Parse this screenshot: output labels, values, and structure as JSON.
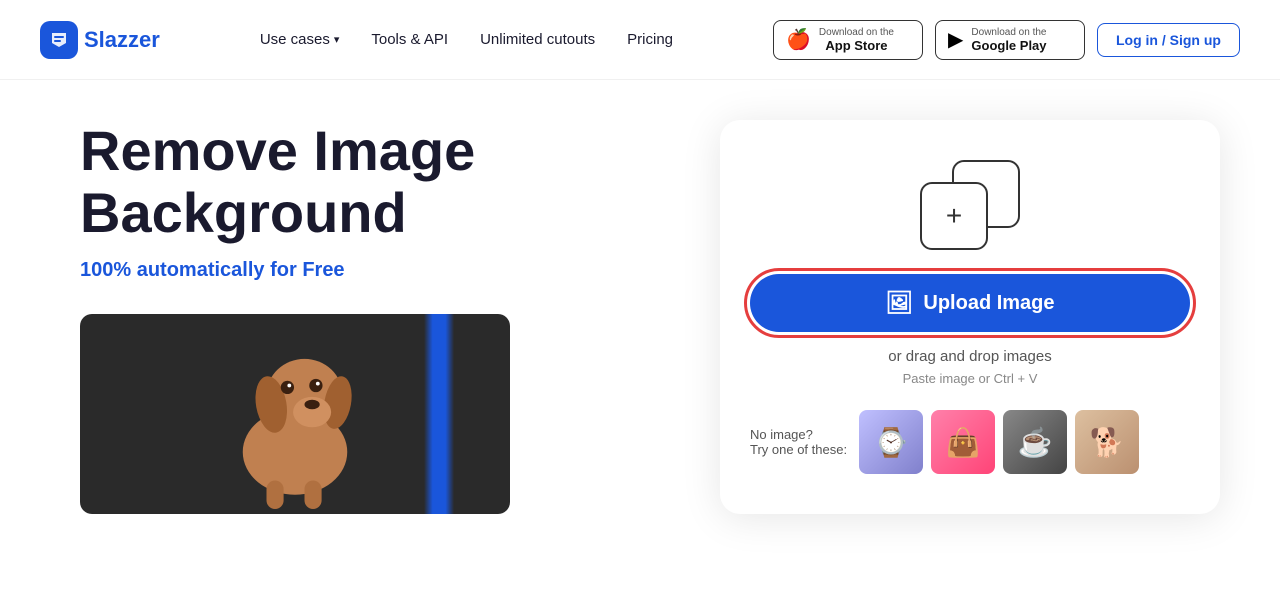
{
  "header": {
    "logo_text": "Slazzer",
    "nav": {
      "use_cases": "Use cases",
      "tools_api": "Tools & API",
      "unlimited_cutouts": "Unlimited cutouts",
      "pricing": "Pricing"
    },
    "app_store": {
      "top": "Download on the",
      "bottom": "App Store"
    },
    "google_play": {
      "top": "Download on the",
      "bottom": "Google Play"
    },
    "login": "Log in / Sign up"
  },
  "hero": {
    "title_line1": "Remove Image",
    "title_line2": "Background",
    "subtitle_start": "100% automatically for ",
    "subtitle_highlight": "Free"
  },
  "upload": {
    "button_label": "Upload Image",
    "drag_text": "or drag and drop images",
    "paste_text": "Paste image or Ctrl + V",
    "sample_label_line1": "No image?",
    "sample_label_line2": "Try one of these:"
  }
}
